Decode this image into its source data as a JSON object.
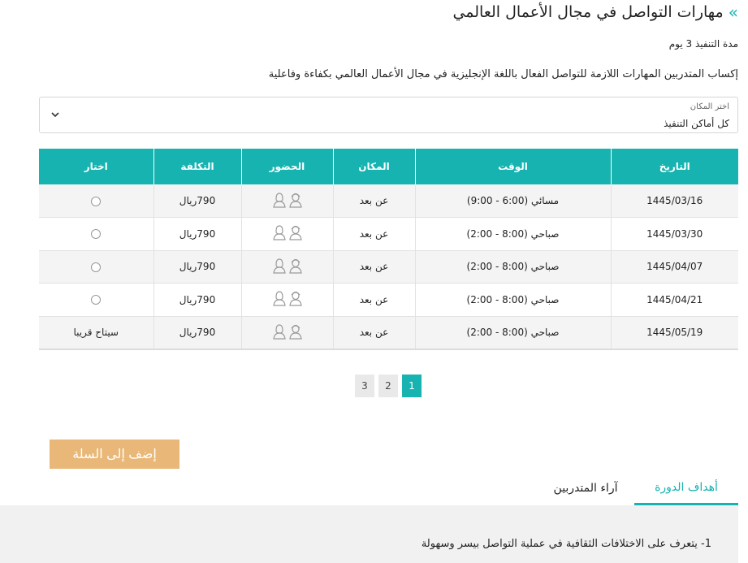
{
  "course": {
    "title": "مهارات التواصل في مجال الأعمال العالمي",
    "title_arrow": "»",
    "duration": "مدة التنفيذ 3 يوم",
    "description": "إكساب المتدربين المهارات اللازمة للتواصل الفعال باللغة الإنجليزية في مجال الأعمال العالمي بكفاءة وفاعلية"
  },
  "location_select": {
    "label": "اختر المكان",
    "value": "كل أماكن التنفيذ"
  },
  "table": {
    "headers": {
      "date": "التاريخ",
      "time": "الوقت",
      "place": "المكان",
      "attendance": "الحضور",
      "cost": "التكلفة",
      "select": "اختار"
    },
    "rows": [
      {
        "date": "1445/03/16",
        "time": "مسائي (6:00 - 9:00)",
        "place": "عن بعد",
        "cost": "790ريال",
        "select": ""
      },
      {
        "date": "1445/03/30",
        "time": "صباحي (8:00 - 2:00)",
        "place": "عن بعد",
        "cost": "790ريال",
        "select": ""
      },
      {
        "date": "1445/04/07",
        "time": "صباحي (8:00 - 2:00)",
        "place": "عن بعد",
        "cost": "790ريال",
        "select": ""
      },
      {
        "date": "1445/04/21",
        "time": "صباحي (8:00 - 2:00)",
        "place": "عن بعد",
        "cost": "790ريال",
        "select": ""
      },
      {
        "date": "1445/05/19",
        "time": "صباحي (8:00 - 2:00)",
        "place": "عن بعد",
        "cost": "790ريال",
        "select": "سيتاح قريبا"
      }
    ]
  },
  "pagination": {
    "pages": [
      "3",
      "2",
      "1"
    ],
    "active": "1"
  },
  "add_to_cart": "إضف إلى السلة",
  "tabs": {
    "goals": "أهداف الدورة",
    "reviews": "آراء المتدربين"
  },
  "goals": {
    "item_1": "1- يتعرف على الاختلافات الثقافية في عملية التواصل بيسر وسهولة"
  },
  "colors": {
    "accent": "#17b3b0",
    "cart_button": "#e9b777"
  }
}
